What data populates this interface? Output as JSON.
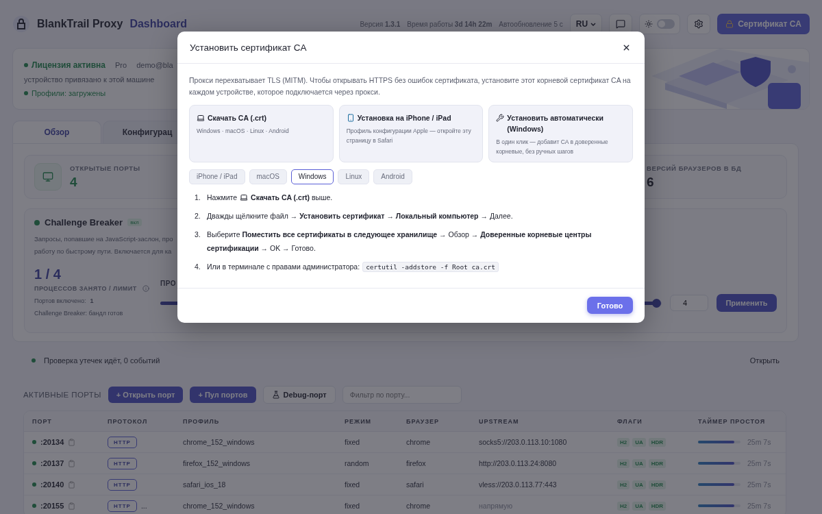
{
  "header": {
    "brand": "BlankTrail Proxy",
    "subtitle": "Dashboard",
    "meta": [
      "Версия **1.3.1**",
      "Время работы **3d 14h 22m**",
      "Автообновление 5 с"
    ],
    "language": "RU",
    "dark_mode": false,
    "cert_button": "Сертификат CA"
  },
  "license": {
    "status": "Лицензия активна",
    "plan": "Pro",
    "email": "demo@bla",
    "note": "устройство привязано к этой машине",
    "profiles": "Профили: загружены"
  },
  "tabs": [
    {
      "label": "Обзор",
      "selected": true
    },
    {
      "label": "Конфигурац",
      "selected": false
    }
  ],
  "stats": [
    {
      "kind": "ports",
      "label": "ОТКРЫТЫЕ ПОРТЫ",
      "value": "4"
    },
    {
      "kind": "browsers",
      "label": "ВЕРСИЙ БРАУЗЕРОВ В БД",
      "value": "6"
    }
  ],
  "challenge": {
    "title": "Challenge Breaker",
    "on": true,
    "badge": "вкл",
    "description": [
      "Запросы, попавшие на JavaScript-заслон, про",
      "работу по быстрому пути. Включается для ка"
    ],
    "usage": "1 / 4",
    "usage_label": "ПРОЦЕССОВ ЗАНЯТО / ЛИМИТ",
    "ports_enabled": "Портов включено: **1**",
    "bundle": "Challenge Breaker: бандл готов",
    "slider_label": "ПРО",
    "level": 0.99,
    "input": "4",
    "apply": "Применить"
  },
  "leak": {
    "text": "Проверка утечек идёт, 0 событий",
    "action": "Открыть"
  },
  "ports": {
    "title": "АКТИВНЫЕ ПОРТЫ",
    "buttons": [
      "+ Открыть порт",
      "+ Пул портов"
    ],
    "debug": "Debug-порт",
    "filter_placeholder": "Фильтр по порту...",
    "columns": [
      "ПОРТ",
      "ПРОТОКОЛ",
      "ПРОФИЛЬ",
      "РЕЖИМ",
      "БРАУЗЕР",
      "UPSTREAM",
      "ФЛАГИ",
      "ТАЙМЕР ПРОСТОЯ"
    ],
    "rows": [
      {
        "port": ":20134",
        "protocol": "HTTP",
        "profile": "chrome_152_windows",
        "mode": "fixed",
        "browser": "chrome",
        "upstream": "socks5://203.0.113.10:1080",
        "direct": false,
        "flags": [
          "H2",
          "UA",
          "HDR"
        ],
        "level": 0.86,
        "idle": "25m 7s"
      },
      {
        "port": ":20137",
        "protocol": "HTTP",
        "profile": "firefox_152_windows",
        "mode": "random",
        "browser": "firefox",
        "upstream": "http://203.0.113.24:8080",
        "direct": false,
        "flags": [
          "H2",
          "UA",
          "HDR"
        ],
        "level": 0.86,
        "idle": "25m 7s"
      },
      {
        "port": ":20140",
        "protocol": "HTTP",
        "profile": "safari_ios_18",
        "mode": "fixed",
        "browser": "safari",
        "upstream": "vless://203.0.113.77:443",
        "direct": false,
        "flags": [
          "H2",
          "UA",
          "HDR"
        ],
        "level": 0.86,
        "idle": "25m 7s"
      },
      {
        "port": ":20155",
        "protocol": "HTTP",
        "protocol_extra": "...",
        "profile": "chrome_152_windows",
        "mode": "fixed",
        "browser": "chrome",
        "upstream": "напрямую",
        "direct": true,
        "flags": [
          "H2",
          "UA",
          "HDR"
        ],
        "level": 0.86,
        "idle": "25m 7s"
      }
    ]
  },
  "modal": {
    "title": "Установить сертификат CA",
    "intro": "Прокси перехватывает TLS (MITM). Чтобы открывать HTTPS без ошибок сертификата, установите этот корневой сертификат CA на каждом устройстве, которое подключается через прокси.",
    "options": [
      {
        "title": "Скачать CA (.crt)",
        "text": "Windows · macOS · Linux · Android"
      },
      {
        "title": "Установка на iPhone / iPad",
        "text": "Профиль конфигурации Apple — откройте эту страницу в Safari"
      },
      {
        "title": "Установить автоматически (Windows)",
        "text": "В один клик — добавит CA в доверенные корневые, без ручных шагов"
      }
    ],
    "platforms": [
      {
        "label": "iPhone / iPad",
        "selected": false
      },
      {
        "label": "macOS",
        "selected": false
      },
      {
        "label": "Windows",
        "selected": true
      },
      {
        "label": "Linux",
        "selected": false
      },
      {
        "label": "Android",
        "selected": false
      }
    ],
    "steps": [
      {
        "number": "1.",
        "text": "Нажмите",
        "after": "**Скачать CA (.crt)** выше."
      },
      {
        "number": "2.",
        "text": "Дважды щёлкните файл → **Установить сертификат → Локальный компьютер** → Далее."
      },
      {
        "number": "3.",
        "text": "Выберите **Поместить все сертификаты в следующее хранилище** → Обзор → **Доверенные корневые центры сертификации** → OK → Готово."
      },
      {
        "number": "4.",
        "text": "Или в терминале с правами администратора:",
        "code": "certutil -addstore -f Root ca.crt"
      }
    ],
    "done": "Готово"
  }
}
